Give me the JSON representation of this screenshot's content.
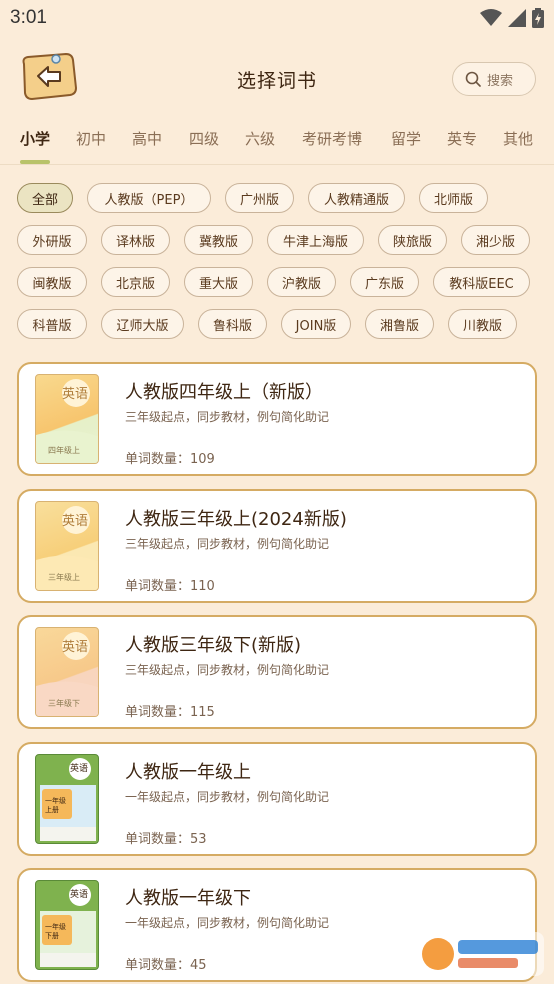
{
  "status_bar": {
    "time": "3:01"
  },
  "header": {
    "title": "选择词书",
    "search_label": "搜索"
  },
  "tabs": [
    {
      "label": "小学",
      "active": true
    },
    {
      "label": "初中"
    },
    {
      "label": "高中"
    },
    {
      "label": "四级"
    },
    {
      "label": "六级"
    },
    {
      "label": "考研考博"
    },
    {
      "label": "留学"
    },
    {
      "label": "英专"
    },
    {
      "label": "其他"
    }
  ],
  "filters": [
    "全部",
    "人教版（PEP）",
    "广州版",
    "人教精通版",
    "北师版",
    "外研版",
    "译林版",
    "冀教版",
    "牛津上海版",
    "陕旅版",
    "湘少版",
    "闽教版",
    "北京版",
    "重大版",
    "沪教版",
    "广东版",
    "教科版EEC",
    "科普版",
    "辽师大版",
    "鲁科版",
    "JOIN版",
    "湘鲁版",
    "川教版"
  ],
  "active_filter": "全部",
  "books": [
    {
      "name": "人教版四年级上（新版）",
      "desc": "三年级起点，同步教材，例句简化助记",
      "count": "单词数量：109",
      "cover_subject": "英语",
      "cover_text": "四年级上",
      "cover_color": "#f7d9a0"
    },
    {
      "name": "人教版三年级上(2024新版)",
      "desc": "三年级起点，同步教材，例句简化助记",
      "count": "单词数量：110",
      "cover_subject": "英语",
      "cover_text": "三年级上",
      "cover_color": "#f9df9c"
    },
    {
      "name": "人教版三年级下(新版)",
      "desc": "三年级起点，同步教材，例句简化助记",
      "count": "单词数量：115",
      "cover_subject": "英语",
      "cover_text": "三年级下",
      "cover_color": "#f8d3b4"
    },
    {
      "name": "人教版一年级上",
      "desc": "一年级起点，同步教材，例句简化助记",
      "count": "单词数量：53",
      "cover_subject": "英语",
      "cover_text": "一年级上册",
      "cover_color": "#7fb24e"
    },
    {
      "name": "人教版一年级下",
      "desc": "一年级起点，同步教材，例句简化助记",
      "count": "单词数量：45",
      "cover_subject": "英语",
      "cover_text": "一年级下册",
      "cover_color": "#7fb24e"
    }
  ],
  "colors": {
    "background": "#fbecd9",
    "card_border": "#d5ab63",
    "tab_underline": "#b9c36a",
    "text_dark": "#3e2612"
  }
}
